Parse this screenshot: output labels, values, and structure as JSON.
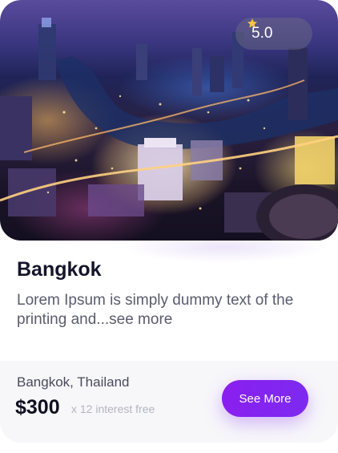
{
  "rating": {
    "value": "5.0",
    "icon": "star-icon",
    "star_color": "#f5c542"
  },
  "destination": {
    "title": "Bangkok",
    "description": "Lorem Ipsum is simply dummy text of the printing and...see more"
  },
  "footer": {
    "location": "Bangkok, Thailand",
    "price": "$300",
    "installment_note": "x 12 interest free",
    "cta_label": "See More"
  },
  "colors": {
    "accent": "#8a1ff0",
    "title_text": "#14142b",
    "body_text": "#5b5b6e",
    "muted_text": "#b4b4c0",
    "footer_bg": "#f7f7fa"
  }
}
